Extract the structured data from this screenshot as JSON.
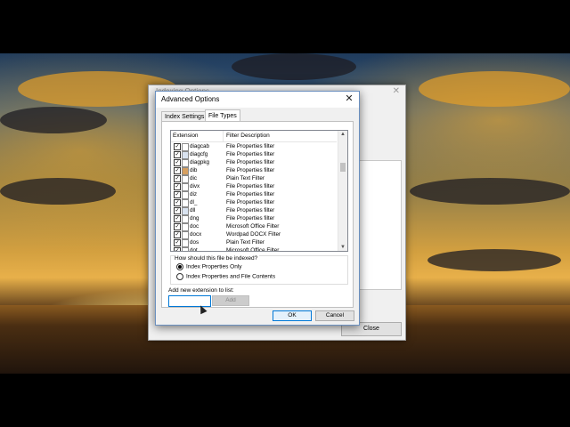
{
  "background_window": {
    "title": "Indexing Options",
    "close_label": "Close"
  },
  "dialog": {
    "title": "Advanced Options",
    "close_glyph": "✕",
    "tabs": [
      {
        "label": "Index Settings",
        "active": false
      },
      {
        "label": "File Types",
        "active": true
      }
    ],
    "list": {
      "col_extension": "Extension",
      "col_description": "Filter Description",
      "rows": [
        {
          "ext": "diagcab",
          "desc": "File Properties filter",
          "icon": "doc-icon"
        },
        {
          "ext": "diagcfg",
          "desc": "File Properties filter",
          "icon": "system-file-icon"
        },
        {
          "ext": "diagpkg",
          "desc": "File Properties filter",
          "icon": "doc-icon"
        },
        {
          "ext": "dib",
          "desc": "File Properties filter",
          "icon": "image-file-icon"
        },
        {
          "ext": "dic",
          "desc": "Plain Text Filter",
          "icon": "doc-icon"
        },
        {
          "ext": "divx",
          "desc": "File Properties filter",
          "icon": "doc-icon"
        },
        {
          "ext": "diz",
          "desc": "File Properties filter",
          "icon": "doc-icon"
        },
        {
          "ext": "dl_",
          "desc": "File Properties filter",
          "icon": "doc-icon"
        },
        {
          "ext": "dll",
          "desc": "File Properties filter",
          "icon": "system-file-icon"
        },
        {
          "ext": "dng",
          "desc": "File Properties filter",
          "icon": "doc-icon"
        },
        {
          "ext": "doc",
          "desc": "Microsoft Office Filter",
          "icon": "doc-icon"
        },
        {
          "ext": "docx",
          "desc": "Wordpad DOCX Filter",
          "icon": "doc-icon"
        },
        {
          "ext": "dos",
          "desc": "Plain Text Filter",
          "icon": "doc-icon"
        },
        {
          "ext": "dot",
          "desc": "Microsoft Office Filter",
          "icon": "doc-icon"
        }
      ]
    },
    "index_group": {
      "question": "How should this file be indexed?",
      "option_properties_only": "Index Properties Only",
      "option_properties_and_contents": "Index Properties and File Contents",
      "selected": "Index Properties Only"
    },
    "add_extension_label": "Add new extension to list:",
    "add_extension_value": "",
    "add_button_label": "Add",
    "ok_label": "OK",
    "cancel_label": "Cancel"
  }
}
